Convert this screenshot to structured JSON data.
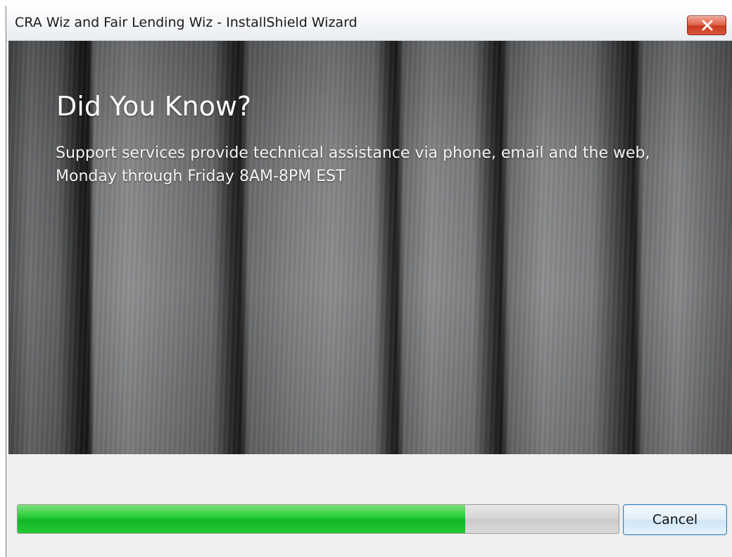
{
  "window": {
    "title": "CRA Wiz and Fair Lending Wiz - InstallShield Wizard",
    "close_icon": "close-icon",
    "close_color": "#c8391f"
  },
  "banner": {
    "heading": "Did You Know?",
    "body": "Support services provide technical assistance via phone, email and the web, Monday through Friday 8AM-8PM EST"
  },
  "progress": {
    "fraction": 0.745,
    "color": "#13b826"
  },
  "buttons": {
    "cancel_label": "Cancel"
  }
}
